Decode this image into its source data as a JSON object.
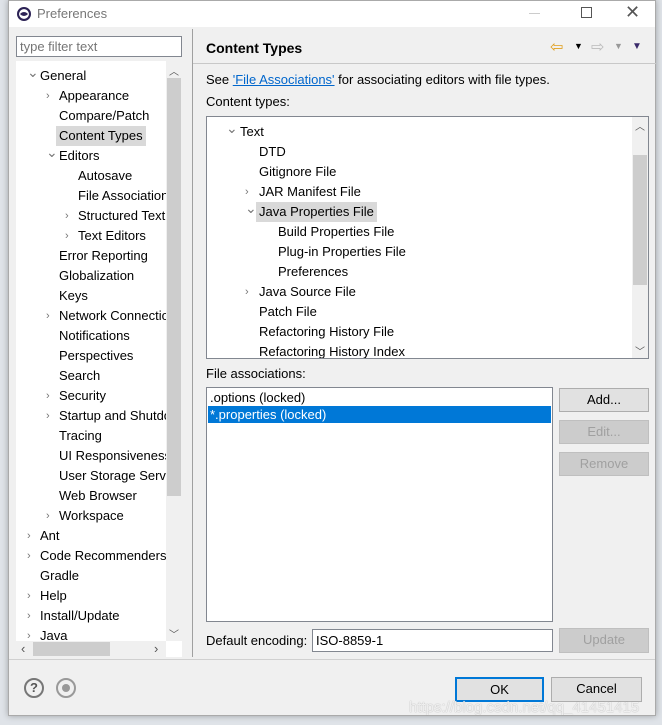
{
  "window": {
    "title": "Preferences"
  },
  "filter": {
    "placeholder": "type filter text"
  },
  "tree": [
    {
      "label": "General",
      "level": 0,
      "chev": "down"
    },
    {
      "label": "Appearance",
      "level": 1,
      "chev": "right"
    },
    {
      "label": "Compare/Patch",
      "level": 1,
      "chev": ""
    },
    {
      "label": "Content Types",
      "level": 1,
      "chev": "",
      "selected": true
    },
    {
      "label": "Editors",
      "level": 1,
      "chev": "down"
    },
    {
      "label": "Autosave",
      "level": 2,
      "chev": ""
    },
    {
      "label": "File Associations",
      "level": 2,
      "chev": ""
    },
    {
      "label": "Structured Text",
      "level": 2,
      "chev": "right"
    },
    {
      "label": "Text Editors",
      "level": 2,
      "chev": "right"
    },
    {
      "label": "Error Reporting",
      "level": 1,
      "chev": ""
    },
    {
      "label": "Globalization",
      "level": 1,
      "chev": ""
    },
    {
      "label": "Keys",
      "level": 1,
      "chev": ""
    },
    {
      "label": "Network Connections",
      "level": 1,
      "chev": "right"
    },
    {
      "label": "Notifications",
      "level": 1,
      "chev": ""
    },
    {
      "label": "Perspectives",
      "level": 1,
      "chev": ""
    },
    {
      "label": "Search",
      "level": 1,
      "chev": ""
    },
    {
      "label": "Security",
      "level": 1,
      "chev": "right"
    },
    {
      "label": "Startup and Shutdown",
      "level": 1,
      "chev": "right"
    },
    {
      "label": "Tracing",
      "level": 1,
      "chev": ""
    },
    {
      "label": "UI Responsiveness",
      "level": 1,
      "chev": ""
    },
    {
      "label": "User Storage Service",
      "level": 1,
      "chev": ""
    },
    {
      "label": "Web Browser",
      "level": 1,
      "chev": ""
    },
    {
      "label": "Workspace",
      "level": 1,
      "chev": "right"
    },
    {
      "label": "Ant",
      "level": 0,
      "chev": "right"
    },
    {
      "label": "Code Recommenders",
      "level": 0,
      "chev": "right"
    },
    {
      "label": "Gradle",
      "level": 0,
      "chev": ""
    },
    {
      "label": "Help",
      "level": 0,
      "chev": "right"
    },
    {
      "label": "Install/Update",
      "level": 0,
      "chev": "right"
    },
    {
      "label": "Java",
      "level": 0,
      "chev": "right"
    }
  ],
  "page": {
    "title": "Content Types",
    "desc_prefix": "See ",
    "desc_link": "'File Associations'",
    "desc_suffix": " for associating editors with file types.",
    "content_types_label": "Content types:",
    "content_types": [
      {
        "label": "Text",
        "level": 0,
        "chev": "down"
      },
      {
        "label": "DTD",
        "level": 1,
        "chev": ""
      },
      {
        "label": "Gitignore File",
        "level": 1,
        "chev": ""
      },
      {
        "label": "JAR Manifest File",
        "level": 1,
        "chev": "right"
      },
      {
        "label": "Java Properties File",
        "level": 1,
        "chev": "down",
        "selected": true
      },
      {
        "label": "Build Properties File",
        "level": 2,
        "chev": ""
      },
      {
        "label": "Plug-in Properties File",
        "level": 2,
        "chev": ""
      },
      {
        "label": "Preferences",
        "level": 2,
        "chev": ""
      },
      {
        "label": "Java Source File",
        "level": 1,
        "chev": "right"
      },
      {
        "label": "Patch File",
        "level": 1,
        "chev": ""
      },
      {
        "label": "Refactoring History File",
        "level": 1,
        "chev": ""
      },
      {
        "label": "Refactoring History Index",
        "level": 1,
        "chev": ""
      }
    ],
    "file_assoc_label": "File associations:",
    "file_assoc": [
      {
        "label": ".options (locked)",
        "selected": false
      },
      {
        "label": "*.properties (locked)",
        "selected": true
      }
    ],
    "add": "Add...",
    "edit": "Edit...",
    "remove": "Remove",
    "encoding_label": "Default encoding:",
    "encoding_value": "ISO-8859-1",
    "update": "Update"
  },
  "footer": {
    "ok": "OK",
    "cancel": "Cancel"
  },
  "watermark": "https://blog.csdn.net/qq_41451415",
  "colors": {
    "selection": "#0078d7",
    "link": "#0066cc"
  }
}
